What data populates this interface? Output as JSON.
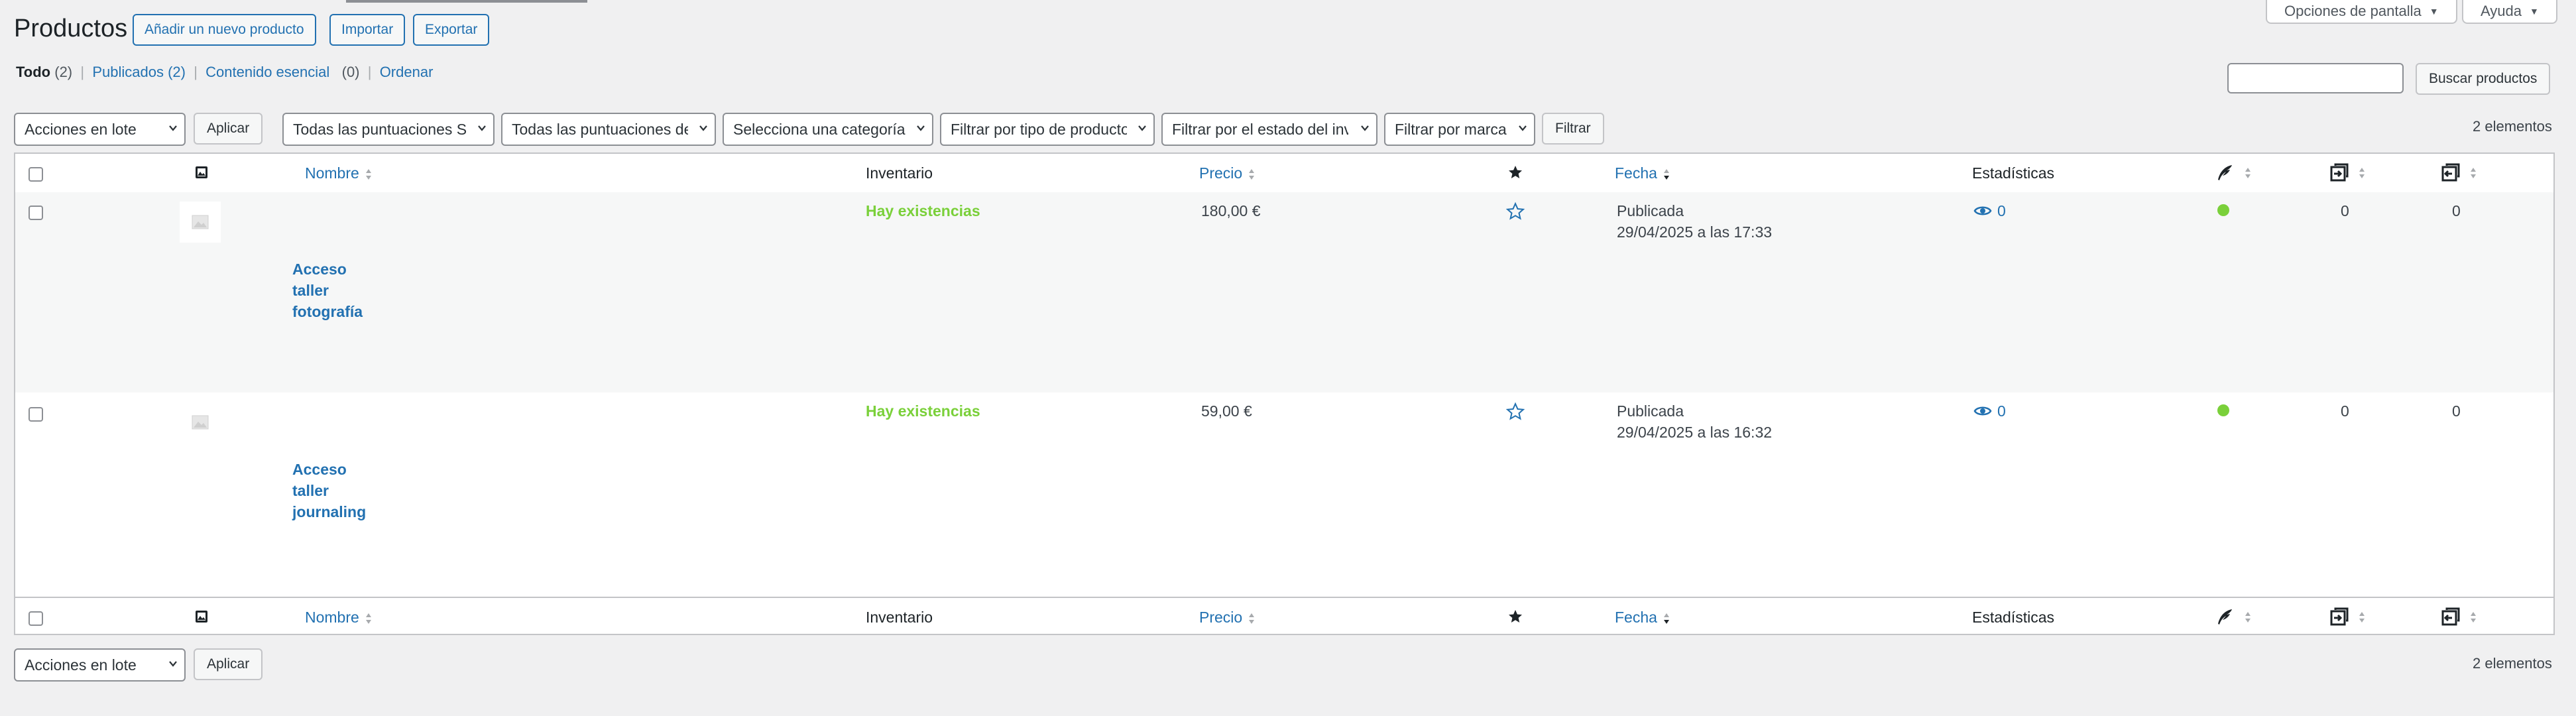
{
  "top": {
    "screen_options": "Opciones de pantalla",
    "help": "Ayuda"
  },
  "header": {
    "title": "Productos",
    "add_new": "Añadir un nuevo producto",
    "import": "Importar",
    "export": "Exportar"
  },
  "views": [
    {
      "label": "Todo",
      "count": "(2)"
    },
    {
      "label": "Publicados",
      "count": "(2)"
    },
    {
      "label": "Contenido esencial",
      "count": "(0)"
    },
    {
      "label": "Ordenar"
    }
  ],
  "search": {
    "button": "Buscar productos",
    "value": ""
  },
  "bulk": {
    "select": "Acciones en lote",
    "apply": "Aplicar"
  },
  "filters": {
    "ratings_1": "Todas las puntuaciones SE",
    "ratings_2": "Todas las puntuaciones de",
    "category": "Selecciona una categoría",
    "type": "Filtrar por tipo de producto",
    "stock": "Filtrar por el estado del inventario",
    "brand": "Filtrar por marca",
    "filter_button": "Filtrar"
  },
  "count": "2 elementos",
  "columns": {
    "name": "Nombre",
    "inventory": "Inventario",
    "price": "Precio",
    "date": "Fecha",
    "stats": "Estadísticas"
  },
  "rows": [
    {
      "name_lines": [
        "Acceso",
        "taller",
        "fotografía"
      ],
      "stock": "Hay existencias",
      "price": "180,00 €",
      "status": "Publicada",
      "date": "29/04/2025 a las 17:33",
      "views": "0",
      "col_a": "0",
      "col_b": "0"
    },
    {
      "name_lines": [
        "Acceso",
        "taller",
        "journaling"
      ],
      "stock": "Hay existencias",
      "price": "59,00 €",
      "status": "Publicada",
      "date": "29/04/2025 a las 16:32",
      "views": "0",
      "col_a": "0",
      "col_b": "0"
    }
  ],
  "colors": {
    "link": "#2271b1",
    "in_stock": "#7ad03a",
    "background": "#f0f0f1"
  }
}
